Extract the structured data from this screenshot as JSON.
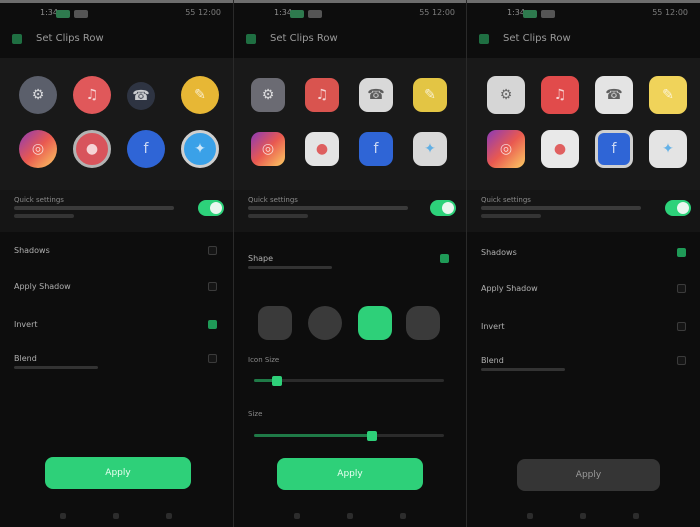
{
  "panels": [
    {
      "title": "Set Clips Row",
      "notice": "Quick settings",
      "rows": [
        {
          "label": "Shadows",
          "checked": false
        },
        {
          "label": "Apply Shadow",
          "checked": false
        },
        {
          "label": "Invert",
          "checked": true
        },
        {
          "label": "Blend",
          "checked": false
        }
      ],
      "apply_label": "Apply"
    },
    {
      "title": "Set Clips Row",
      "notice": "Quick settings",
      "section_label": "Shape",
      "slider1_label": "Icon Size",
      "slider2_label": "Size",
      "apply_label": "Apply"
    },
    {
      "title": "Set Clips Row",
      "notice": "Quick settings",
      "rows": [
        {
          "label": "Shadows",
          "checked": true
        },
        {
          "label": "Apply Shadow",
          "checked": false
        },
        {
          "label": "Invert",
          "checked": false
        },
        {
          "label": "Blend",
          "checked": false
        }
      ],
      "apply_label": "Apply"
    }
  ],
  "status": {
    "time": "1:34",
    "right": "55 12:00"
  },
  "colors": {
    "accent": "#2ed079",
    "background": "#0d0d0d",
    "surface": "#191919"
  },
  "icons": [
    "settings-icon",
    "music-icon",
    "phone-icon",
    "notes-icon",
    "instagram-icon",
    "camera-icon",
    "facebook-icon",
    "twitter-icon"
  ],
  "slider_values": {
    "icon_size": 0.12,
    "size": 0.62
  }
}
